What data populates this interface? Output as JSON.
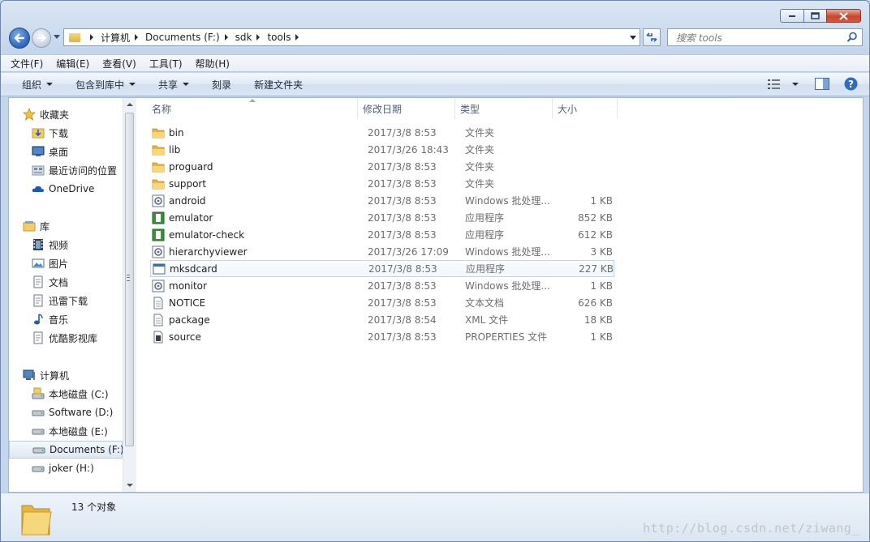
{
  "window": {
    "caption": {
      "minimize": "minimize",
      "maximize": "maximize",
      "close": "close"
    }
  },
  "address": {
    "segments": [
      "计算机",
      "Documents (F:)",
      "sdk",
      "tools"
    ]
  },
  "search": {
    "placeholder": "搜索 tools"
  },
  "menubar": [
    {
      "label": "文件(F)"
    },
    {
      "label": "编辑(E)"
    },
    {
      "label": "查看(V)"
    },
    {
      "label": "工具(T)"
    },
    {
      "label": "帮助(H)"
    }
  ],
  "toolbar": {
    "organize": "组织",
    "include": "包含到库中",
    "share": "共享",
    "burn": "刻录",
    "new_folder": "新建文件夹"
  },
  "navpane": {
    "favorites": {
      "label": "收藏夹",
      "items": [
        "下载",
        "桌面",
        "最近访问的位置",
        "OneDrive"
      ]
    },
    "libraries": {
      "label": "库",
      "items": [
        "视频",
        "图片",
        "文档",
        "迅雷下载",
        "音乐",
        "优酷影视库"
      ]
    },
    "computer": {
      "label": "计算机",
      "items": [
        "本地磁盘 (C:)",
        "Software (D:)",
        "本地磁盘 (E:)",
        "Documents (F:)",
        "joker (H:)"
      ],
      "selected": "Documents (F:)"
    }
  },
  "columns": {
    "name": "名称",
    "date": "修改日期",
    "type": "类型",
    "size": "大小"
  },
  "files": [
    {
      "name": "bin",
      "date": "2017/3/8 8:53",
      "type": "文件夹",
      "size": "",
      "icon": "folder"
    },
    {
      "name": "lib",
      "date": "2017/3/26 18:43",
      "type": "文件夹",
      "size": "",
      "icon": "folder"
    },
    {
      "name": "proguard",
      "date": "2017/3/8 8:53",
      "type": "文件夹",
      "size": "",
      "icon": "folder"
    },
    {
      "name": "support",
      "date": "2017/3/8 8:53",
      "type": "文件夹",
      "size": "",
      "icon": "folder"
    },
    {
      "name": "android",
      "date": "2017/3/8 8:53",
      "type": "Windows 批处理...",
      "size": "1 KB",
      "icon": "batch"
    },
    {
      "name": "emulator",
      "date": "2017/3/8 8:53",
      "type": "应用程序",
      "size": "852 KB",
      "icon": "app-green"
    },
    {
      "name": "emulator-check",
      "date": "2017/3/8 8:53",
      "type": "应用程序",
      "size": "612 KB",
      "icon": "app-green"
    },
    {
      "name": "hierarchyviewer",
      "date": "2017/3/26 17:09",
      "type": "Windows 批处理...",
      "size": "3 KB",
      "icon": "batch"
    },
    {
      "name": "mksdcard",
      "date": "2017/3/8 8:53",
      "type": "应用程序",
      "size": "227 KB",
      "icon": "app-window"
    },
    {
      "name": "monitor",
      "date": "2017/3/8 8:53",
      "type": "Windows 批处理...",
      "size": "1 KB",
      "icon": "batch"
    },
    {
      "name": "NOTICE",
      "date": "2017/3/8 8:53",
      "type": "文本文档",
      "size": "626 KB",
      "icon": "text"
    },
    {
      "name": "package",
      "date": "2017/3/8 8:54",
      "type": "XML 文件",
      "size": "18 KB",
      "icon": "text"
    },
    {
      "name": "source",
      "date": "2017/3/8 8:53",
      "type": "PROPERTIES 文件",
      "size": "1 KB",
      "icon": "properties"
    }
  ],
  "hovered_file": "mksdcard",
  "status": {
    "count": "13 个对象"
  },
  "watermark": "http://blog.csdn.net/ziwang_"
}
